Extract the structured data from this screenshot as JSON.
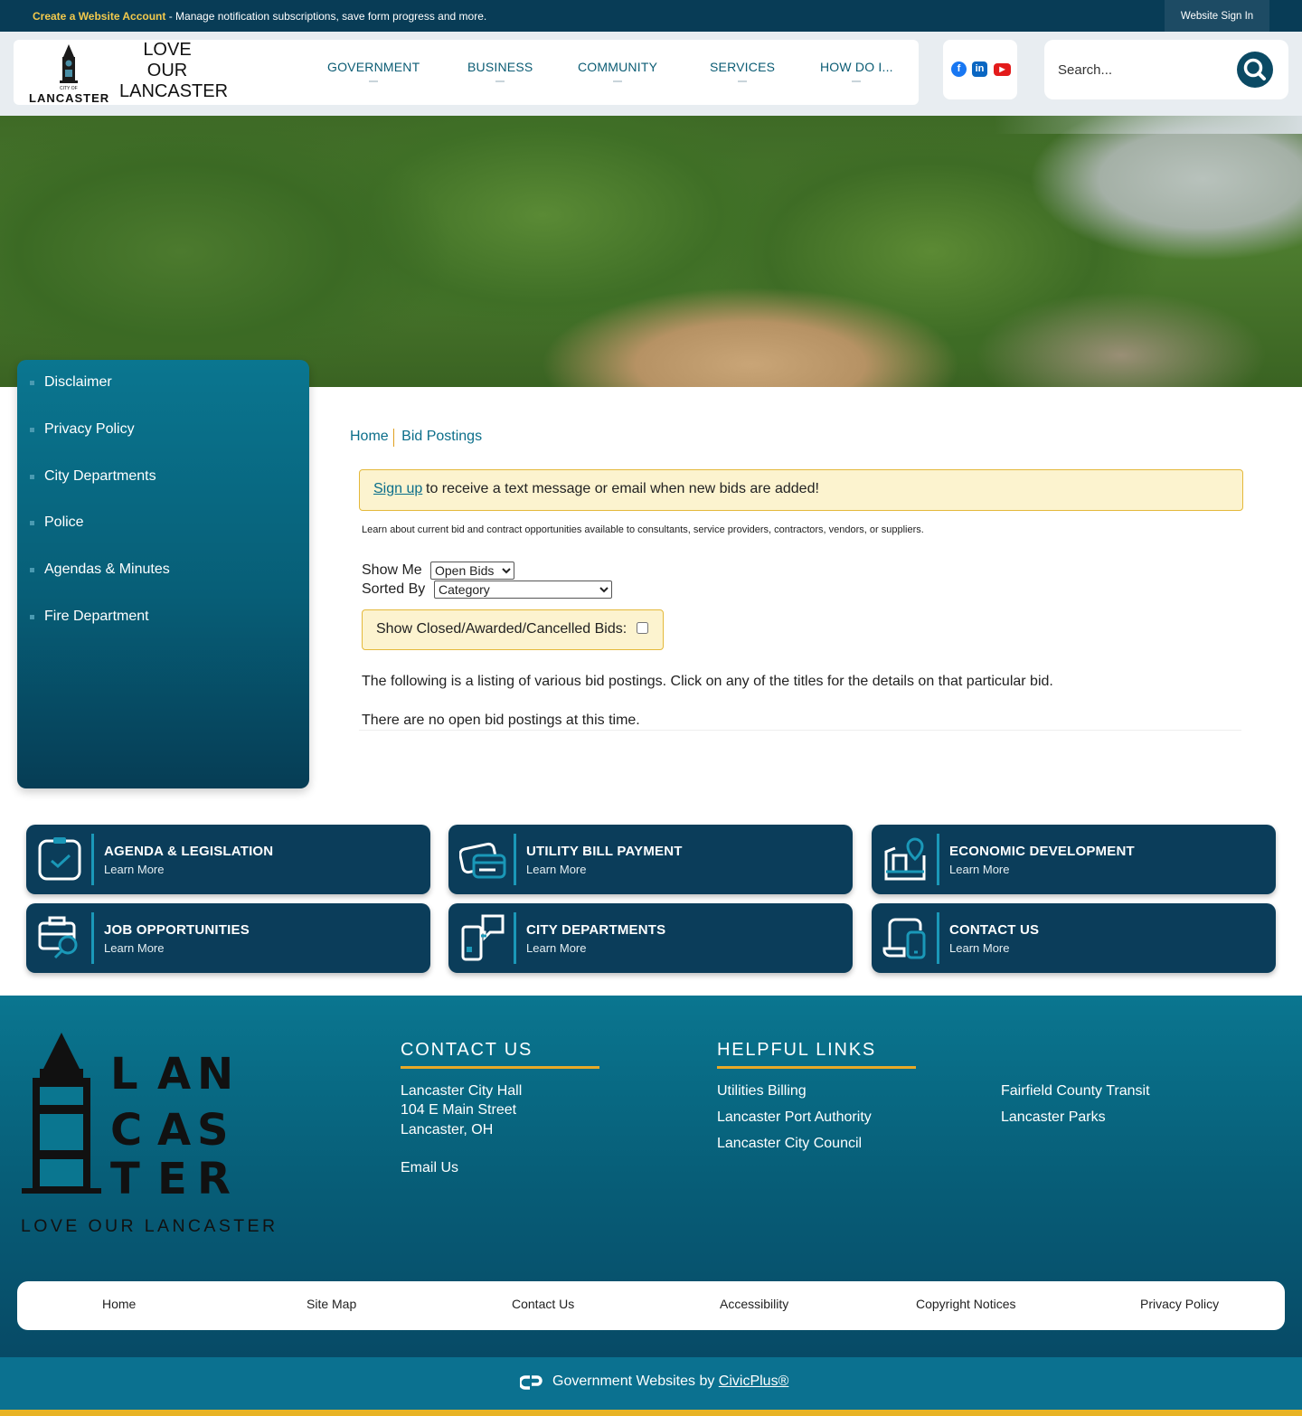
{
  "topbar": {
    "create_label": "Create a Website Account",
    "message": " - Manage notification subscriptions, save form progress and more.",
    "signin_label": "Website Sign In"
  },
  "header": {
    "logo_city": "LANCASTER",
    "logo_city_of": "CITY OF",
    "logo_tagline": [
      "LOVE",
      "OUR",
      "LANCASTER"
    ],
    "nav": [
      "GOVERNMENT",
      "BUSINESS",
      "COMMUNITY",
      "SERVICES",
      "HOW DO I..."
    ],
    "social": [
      "facebook-icon",
      "linkedin-icon",
      "youtube-icon"
    ],
    "search_placeholder": "Search..."
  },
  "sidebar": {
    "items": [
      "Disclaimer",
      "Privacy Policy",
      "City Departments",
      "Police",
      "Agendas & Minutes",
      "Fire Department"
    ]
  },
  "breadcrumb": [
    "Home",
    "Bid Postings"
  ],
  "main": {
    "alert_link": "Sign up",
    "alert_text": "to receive a text message or email when new bids are added!",
    "intro": "Learn about current bid and contract opportunities available to consultants, service providers, contractors, vendors, or suppliers.",
    "show_me_label": "Show Me",
    "show_me_value": "Open Bids",
    "sorted_by_label": "Sorted By",
    "sorted_by_value": "Category",
    "closed_label": "Show Closed/Awarded/Cancelled Bids:",
    "listing_text": "The following is a listing of various bid postings. Click on any of the titles for the details on that particular bid.",
    "no_bids_text": "There are no open bid postings at this time."
  },
  "tiles": [
    {
      "title": "AGENDA & LEGISLATION",
      "sub": "Learn More",
      "icon": "clipboard-check-icon"
    },
    {
      "title": "UTILITY BILL PAYMENT",
      "sub": "Learn More",
      "icon": "credit-card-icon"
    },
    {
      "title": "ECONOMIC DEVELOPMENT",
      "sub": "Learn More",
      "icon": "map-pin-icon"
    },
    {
      "title": "JOB OPPORTUNITIES",
      "sub": "Learn More",
      "icon": "briefcase-search-icon"
    },
    {
      "title": "CITY DEPARTMENTS",
      "sub": "Learn More",
      "icon": "phone-chat-icon"
    },
    {
      "title": "CONTACT US",
      "sub": "Learn More",
      "icon": "devices-icon"
    }
  ],
  "footer": {
    "logo_letters": [
      "L",
      "A",
      "N",
      "C",
      "A",
      "S",
      "T",
      "E",
      "R"
    ],
    "logo_tagline": "LOVE OUR LANCASTER",
    "contact_heading": "CONTACT US",
    "contact_lines": [
      "Lancaster City Hall",
      "104 E Main Street",
      "Lancaster, OH"
    ],
    "email_label": "Email Us",
    "links_heading": "HELPFUL LINKS",
    "links_col1": [
      "Utilities Billing",
      "Lancaster Port Authority",
      "Lancaster City Council"
    ],
    "links_col2": [
      "Fairfield County Transit",
      "Lancaster Parks"
    ]
  },
  "bottom_links": [
    "Home",
    "Site Map",
    "Contact Us",
    "Accessibility",
    "Copyright Notices",
    "Privacy Policy"
  ],
  "civic": {
    "prefix": "Government Websites by ",
    "link": "CivicPlus®"
  },
  "colors": {
    "navy": "#0b3d5a",
    "teal": "#0a7690",
    "gold": "#e8a927",
    "alert_bg": "#fcf3cf"
  }
}
